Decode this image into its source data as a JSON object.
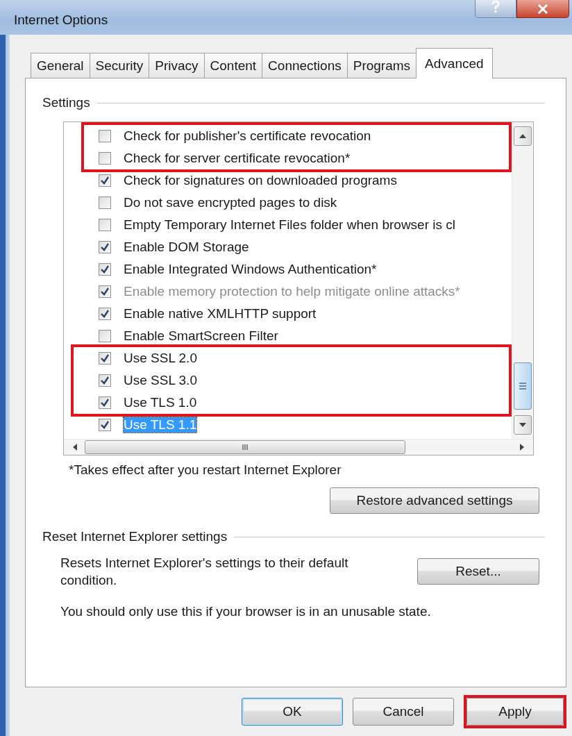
{
  "window": {
    "title": "Internet Options"
  },
  "tabs": [
    {
      "label": "General",
      "selected": false
    },
    {
      "label": "Security",
      "selected": false
    },
    {
      "label": "Privacy",
      "selected": false
    },
    {
      "label": "Content",
      "selected": false
    },
    {
      "label": "Connections",
      "selected": false
    },
    {
      "label": "Programs",
      "selected": false
    },
    {
      "label": "Advanced",
      "selected": true
    }
  ],
  "settings": {
    "label": "Settings",
    "items": [
      {
        "label": "Check for publisher's certificate revocation",
        "checked": false,
        "disabled": false,
        "selected": false,
        "highlighted": true
      },
      {
        "label": "Check for server certificate revocation*",
        "checked": false,
        "disabled": false,
        "selected": false,
        "highlighted": true
      },
      {
        "label": "Check for signatures on downloaded programs",
        "checked": true,
        "disabled": false,
        "selected": false,
        "highlighted": false
      },
      {
        "label": "Do not save encrypted pages to disk",
        "checked": false,
        "disabled": false,
        "selected": false,
        "highlighted": false
      },
      {
        "label": "Empty Temporary Internet Files folder when browser is cl",
        "checked": false,
        "disabled": false,
        "selected": false,
        "highlighted": false
      },
      {
        "label": "Enable DOM Storage",
        "checked": true,
        "disabled": false,
        "selected": false,
        "highlighted": false
      },
      {
        "label": "Enable Integrated Windows Authentication*",
        "checked": true,
        "disabled": false,
        "selected": false,
        "highlighted": false
      },
      {
        "label": "Enable memory protection to help mitigate online attacks*",
        "checked": true,
        "disabled": true,
        "selected": false,
        "highlighted": false
      },
      {
        "label": "Enable native XMLHTTP support",
        "checked": true,
        "disabled": false,
        "selected": false,
        "highlighted": false
      },
      {
        "label": "Enable SmartScreen Filter",
        "checked": false,
        "disabled": false,
        "selected": false,
        "highlighted": false
      },
      {
        "label": "Use SSL 2.0",
        "checked": true,
        "disabled": false,
        "selected": false,
        "highlighted": true
      },
      {
        "label": "Use SSL 3.0",
        "checked": true,
        "disabled": false,
        "selected": false,
        "highlighted": true
      },
      {
        "label": "Use TLS 1.0",
        "checked": true,
        "disabled": false,
        "selected": false,
        "highlighted": true
      },
      {
        "label": "Use TLS 1.1",
        "checked": true,
        "disabled": false,
        "selected": true,
        "highlighted": false
      }
    ],
    "footnote": "*Takes effect after you restart Internet Explorer",
    "restore_button": {
      "label": "Restore advanced settings"
    }
  },
  "reset": {
    "label": "Reset Internet Explorer settings",
    "description": "Resets Internet Explorer's settings to their default condition.",
    "button": {
      "label": "Reset..."
    },
    "note": "You should only use this if your browser is in an unusable state."
  },
  "buttons": [
    {
      "label": "OK",
      "default": true,
      "highlighted": false
    },
    {
      "label": "Cancel",
      "default": false,
      "highlighted": false
    },
    {
      "label": "Apply",
      "default": false,
      "highlighted": true
    }
  ]
}
